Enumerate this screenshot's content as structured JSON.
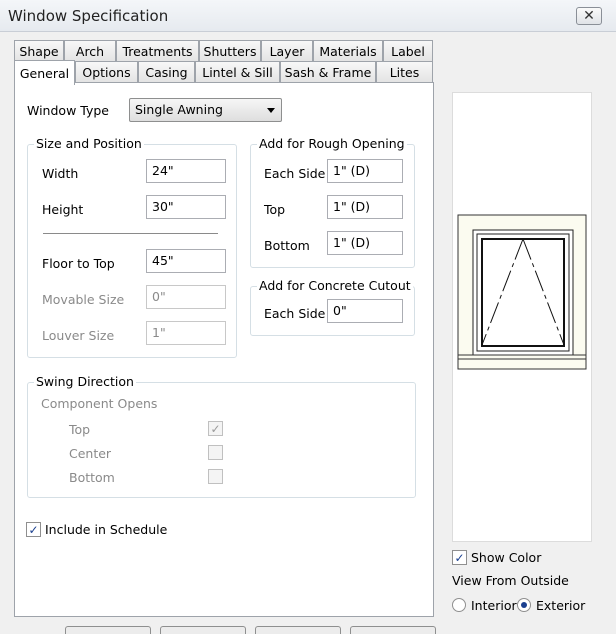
{
  "window": {
    "title": "Window Specification"
  },
  "tabs_row1": [
    "Shape",
    "Arch",
    "Treatments",
    "Shutters",
    "Layer",
    "Materials",
    "Label"
  ],
  "tabs_row2": [
    "General",
    "Options",
    "Casing",
    "Lintel & Sill",
    "Sash & Frame",
    "Lites"
  ],
  "active_tab": "General",
  "window_type": {
    "label": "Window Type",
    "value": "Single Awning"
  },
  "size_position": {
    "title": "Size and Position",
    "width": {
      "label": "Width",
      "value": "24\""
    },
    "height": {
      "label": "Height",
      "value": "30\""
    },
    "floor_to_top": {
      "label": "Floor to Top",
      "value": "45\""
    },
    "movable_size": {
      "label": "Movable Size",
      "value": "0\""
    },
    "louver_size": {
      "label": "Louver Size",
      "value": "1\""
    }
  },
  "rough_opening": {
    "title": "Add for Rough Opening",
    "each_side": {
      "label": "Each Side",
      "value": "1\" (D)"
    },
    "top": {
      "label": "Top",
      "value": "1\" (D)"
    },
    "bottom": {
      "label": "Bottom",
      "value": "1\" (D)"
    }
  },
  "concrete_cutout": {
    "title": "Add for Concrete Cutout",
    "each_side": {
      "label": "Each Side",
      "value": "0\""
    }
  },
  "swing_direction": {
    "title": "Swing Direction",
    "subtitle": "Component Opens",
    "options": [
      {
        "label": "Top",
        "checked": true
      },
      {
        "label": "Center",
        "checked": false
      },
      {
        "label": "Bottom",
        "checked": false
      }
    ]
  },
  "include_schedule": {
    "label": "Include in Schedule",
    "checked": true
  },
  "preview_controls": {
    "show_color": {
      "label": "Show Color",
      "checked": true
    },
    "view_from_outside": "View From Outside",
    "interior": {
      "label": "Interior",
      "selected": false
    },
    "exterior": {
      "label": "Exterior",
      "selected": true
    }
  },
  "icons": {
    "close": "close-icon",
    "dropdown": "chevron-down-icon",
    "check": "checkmark-icon"
  },
  "colors": {
    "accent": "#1a3f8f",
    "disabled_text": "#8a8a8a",
    "group_border": "#d5dfe5"
  }
}
